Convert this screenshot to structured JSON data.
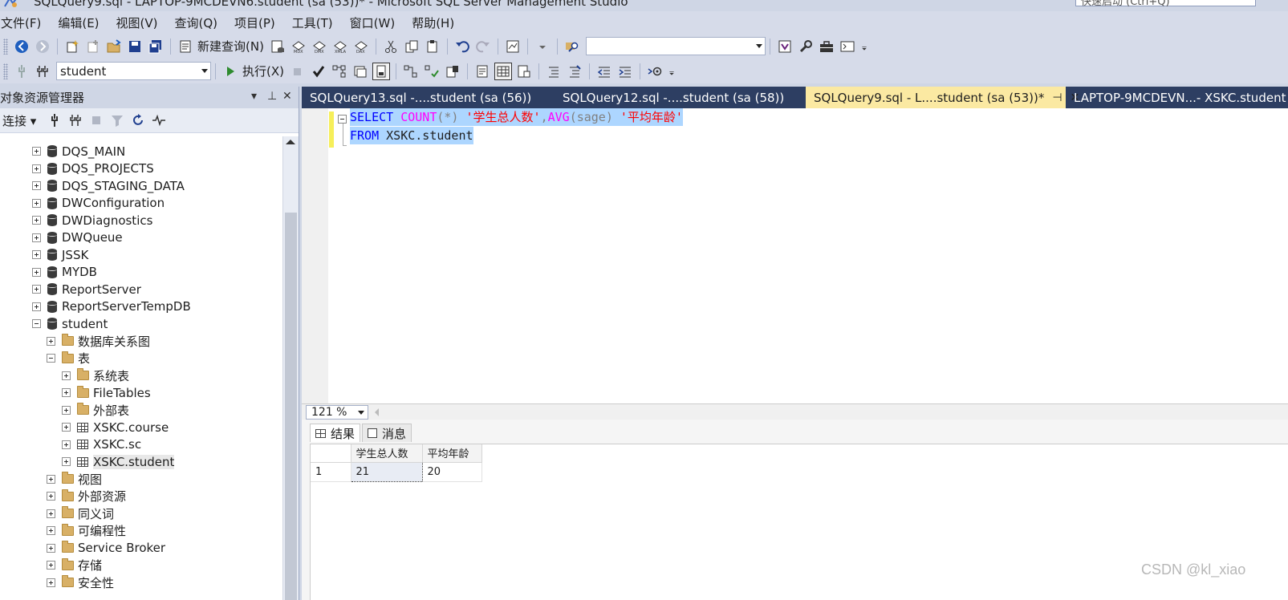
{
  "window": {
    "title": "SQLQuery9.sql - LAPTOP-9MCDEVN6.student (sa (53))* - Microsoft SQL Server Management Studio",
    "quick_launch_placeholder": "快速启动 (Ctrl+Q)"
  },
  "menu": [
    "文件(F)",
    "编辑(E)",
    "视图(V)",
    "查询(Q)",
    "项目(P)",
    "工具(T)",
    "窗口(W)",
    "帮助(H)"
  ],
  "toolbar1": {
    "new_query_label": "新建查询(N)",
    "search_combo_value": ""
  },
  "toolbar2": {
    "database_selected": "student",
    "execute_label": "执行(X)"
  },
  "object_explorer": {
    "title": "对象资源管理器",
    "connect_label": "连接",
    "tree": [
      {
        "label": "DQS_MAIN",
        "icon": "database",
        "level": 0,
        "expander": "plus"
      },
      {
        "label": "DQS_PROJECTS",
        "icon": "database",
        "level": 0,
        "expander": "plus"
      },
      {
        "label": "DQS_STAGING_DATA",
        "icon": "database",
        "level": 0,
        "expander": "plus"
      },
      {
        "label": "DWConfiguration",
        "icon": "database",
        "level": 0,
        "expander": "plus"
      },
      {
        "label": "DWDiagnostics",
        "icon": "database",
        "level": 0,
        "expander": "plus"
      },
      {
        "label": "DWQueue",
        "icon": "database",
        "level": 0,
        "expander": "plus"
      },
      {
        "label": "JSSK",
        "icon": "database",
        "level": 0,
        "expander": "plus"
      },
      {
        "label": "MYDB",
        "icon": "database",
        "level": 0,
        "expander": "plus"
      },
      {
        "label": "ReportServer",
        "icon": "database",
        "level": 0,
        "expander": "plus"
      },
      {
        "label": "ReportServerTempDB",
        "icon": "database",
        "level": 0,
        "expander": "plus"
      },
      {
        "label": "student",
        "icon": "database",
        "level": 0,
        "expander": "minus"
      },
      {
        "label": "数据库关系图",
        "icon": "folder",
        "level": 1,
        "expander": "plus"
      },
      {
        "label": "表",
        "icon": "folder",
        "level": 1,
        "expander": "minus"
      },
      {
        "label": "系统表",
        "icon": "folder",
        "level": 2,
        "expander": "plus"
      },
      {
        "label": "FileTables",
        "icon": "folder",
        "level": 2,
        "expander": "plus"
      },
      {
        "label": "外部表",
        "icon": "folder",
        "level": 2,
        "expander": "plus"
      },
      {
        "label": "XSKC.course",
        "icon": "table",
        "level": 2,
        "expander": "plus"
      },
      {
        "label": "XSKC.sc",
        "icon": "table",
        "level": 2,
        "expander": "plus"
      },
      {
        "label": "XSKC.student",
        "icon": "table",
        "level": 2,
        "expander": "plus",
        "selected": true
      },
      {
        "label": "视图",
        "icon": "folder",
        "level": 1,
        "expander": "plus"
      },
      {
        "label": "外部资源",
        "icon": "folder",
        "level": 1,
        "expander": "plus"
      },
      {
        "label": "同义词",
        "icon": "folder",
        "level": 1,
        "expander": "plus"
      },
      {
        "label": "可编程性",
        "icon": "folder",
        "level": 1,
        "expander": "plus"
      },
      {
        "label": "Service Broker",
        "icon": "folder",
        "level": 1,
        "expander": "plus"
      },
      {
        "label": "存储",
        "icon": "folder",
        "level": 1,
        "expander": "plus"
      },
      {
        "label": "安全性",
        "icon": "folder",
        "level": 1,
        "expander": "plus"
      }
    ]
  },
  "doc_tabs": [
    {
      "label": "SQLQuery13.sql -....student (sa (56))",
      "active": false
    },
    {
      "label": "SQLQuery12.sql -....student (sa (58))",
      "active": false
    },
    {
      "label": "SQLQuery9.sql - L....student (sa (53))*",
      "active": true
    },
    {
      "label": "LAPTOP-9MCDEVN...- XSKC.student",
      "active": false
    }
  ],
  "editor": {
    "line1": {
      "kw1": "SELECT",
      "fn1": "COUNT",
      "arg1": "(*)",
      "str1": "'学生总人数'",
      "comma": ",",
      "fn2": "AVG",
      "arg2": "(sage)",
      "str2": "'平均年龄'"
    },
    "line2": {
      "kw": "FROM",
      "rest": "XSKC.student"
    }
  },
  "zoom": "121 %",
  "results": {
    "tab_results": "结果",
    "tab_messages": "消息",
    "columns": [
      "学生总人数",
      "平均年龄"
    ],
    "rows": [
      {
        "num": "1",
        "cells": [
          "21",
          "20"
        ]
      }
    ]
  },
  "watermark": "CSDN @kl_xiao",
  "colors": {
    "active_tab": "#fbe9a2",
    "tab_bar": "#2d3e62",
    "selection": "#add6ff"
  }
}
